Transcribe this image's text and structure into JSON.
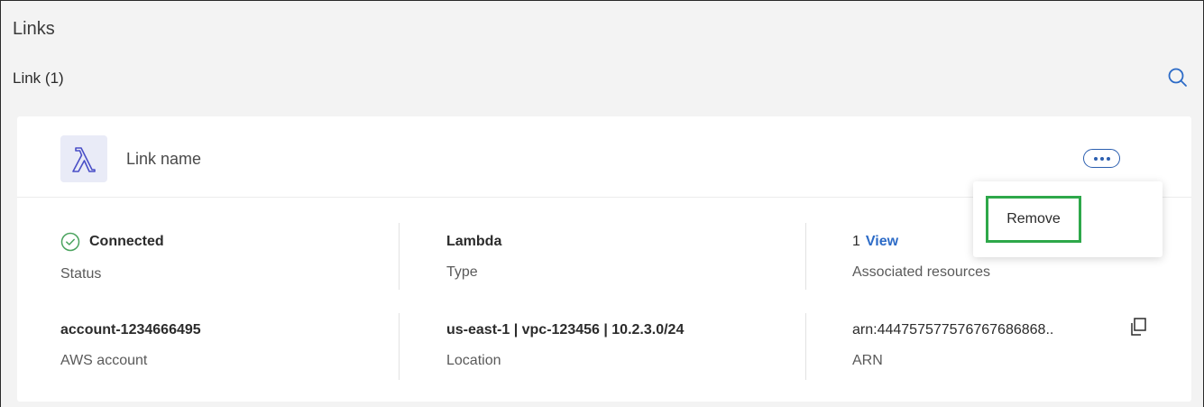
{
  "page": {
    "title": "Links"
  },
  "section": {
    "title": "Link (1)"
  },
  "icons": {
    "search": "search-icon",
    "lambda": "lambda-icon",
    "more": "more-icon",
    "check": "check-circle-icon",
    "copy": "copy-icon"
  },
  "colors": {
    "accent": "#2c6bc7",
    "success": "#4aa35e",
    "highlight_border": "#2ea84a",
    "lambda_tile_bg": "#e9ebf7"
  },
  "card": {
    "name": "Link name",
    "status": {
      "value": "Connected",
      "label": "Status"
    },
    "type": {
      "value": "Lambda",
      "label": "Type"
    },
    "associated": {
      "count": "1",
      "link": "View",
      "label": "Associated resources"
    },
    "account": {
      "value": "account-1234666495",
      "label": "AWS account"
    },
    "location": {
      "value": "us-east-1 | vpc-123456 | 10.2.3.0/24",
      "label": "Location"
    },
    "arn": {
      "value": "arn:444757577576767686868..",
      "label": "ARN"
    }
  },
  "menu": {
    "items": [
      {
        "label": "Remove"
      }
    ]
  }
}
